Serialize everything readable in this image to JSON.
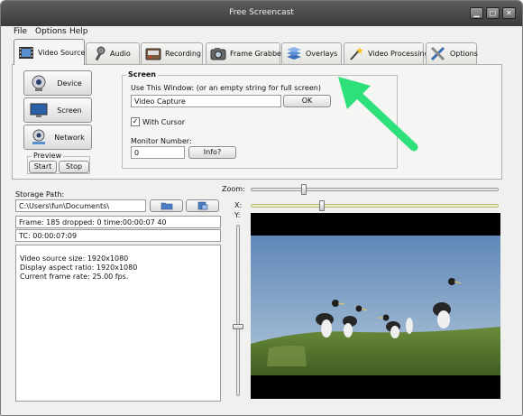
{
  "window": {
    "title": "Free Screencast"
  },
  "menu": [
    "File",
    "Options",
    "Help"
  ],
  "tabs": [
    {
      "label": "Video Source",
      "icon": "film-icon"
    },
    {
      "label": "Audio",
      "icon": "microphone-icon"
    },
    {
      "label": "Recording",
      "icon": "recorder-icon"
    },
    {
      "label": "Frame Grabber",
      "icon": "camera-icon"
    },
    {
      "label": "Overlays",
      "icon": "layers-icon"
    },
    {
      "label": "Video Processing",
      "icon": "wand-icon"
    },
    {
      "label": "Options",
      "icon": "tools-icon"
    }
  ],
  "source_buttons": {
    "device": "Device",
    "screen": "Screen",
    "network": "Network"
  },
  "preview": {
    "label": "Preview",
    "start": "Start",
    "stop": "Stop"
  },
  "screen_group": {
    "title": "Screen",
    "use_window_label": "Use This Window:  (or an empty string for full screen)",
    "window_value": "Video Capture",
    "ok": "OK",
    "with_cursor_label": "With Cursor",
    "with_cursor_checked": "✓",
    "monitor_label": "Monitor Number:",
    "monitor_value": "0",
    "info_button": "Info?"
  },
  "storage": {
    "label": "Storage Path:",
    "path": "C:\\Users\\fun\\Documents\\"
  },
  "status": {
    "frame": "Frame: 185 dropped: 0 time:00:00:07 40",
    "tc": "TC: 00:00:07:09"
  },
  "info": {
    "lines": [
      "Video source size: 1920x1080",
      "Display aspect ratio: 1920x1080",
      "Current frame rate: 25.00 fps."
    ]
  },
  "view_controls": {
    "zoom_label": "Zoom:",
    "x_label": "X:",
    "y_label": "Y:"
  },
  "colors": {
    "titlebar": "#4a4a4a",
    "arrow": "#2ee07a",
    "sky": "#6f94bd",
    "grass": "#5b7d32"
  }
}
